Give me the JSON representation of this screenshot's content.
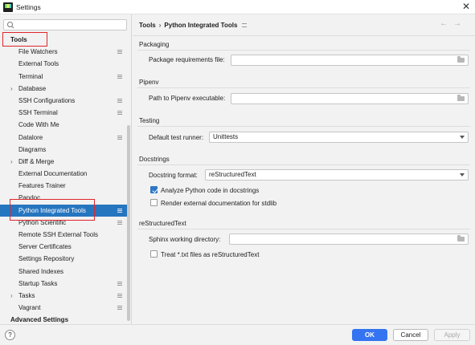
{
  "window": {
    "title": "Settings"
  },
  "search": {
    "placeholder": "",
    "value": ""
  },
  "sidebar": {
    "items": [
      {
        "label": "Tools",
        "type": "header"
      },
      {
        "label": "File Watchers",
        "proj": true
      },
      {
        "label": "External Tools"
      },
      {
        "label": "Terminal",
        "proj": true
      },
      {
        "label": "Database",
        "expandable": true
      },
      {
        "label": "SSH Configurations",
        "proj": true
      },
      {
        "label": "SSH Terminal",
        "proj": true
      },
      {
        "label": "Code With Me"
      },
      {
        "label": "Datalore",
        "proj": true
      },
      {
        "label": "Diagrams"
      },
      {
        "label": "Diff & Merge",
        "expandable": true
      },
      {
        "label": "External Documentation"
      },
      {
        "label": "Features Trainer"
      },
      {
        "label": "Pandoc"
      },
      {
        "label": "Python Integrated Tools",
        "proj": true,
        "selected": true
      },
      {
        "label": "Python Scientific",
        "proj": true
      },
      {
        "label": "Remote SSH External Tools"
      },
      {
        "label": "Server Certificates"
      },
      {
        "label": "Settings Repository"
      },
      {
        "label": "Shared Indexes"
      },
      {
        "label": "Startup Tasks",
        "proj": true
      },
      {
        "label": "Tasks",
        "expandable": true,
        "proj": true
      },
      {
        "label": "Vagrant",
        "proj": true
      },
      {
        "label": "Advanced Settings",
        "type": "header"
      }
    ]
  },
  "breadcrumb": {
    "parent": "Tools",
    "separator": "›",
    "current": "Python Integrated Tools"
  },
  "nav": {
    "back": "←",
    "forward": "→"
  },
  "packaging": {
    "title": "Packaging",
    "requirements_label": "Package requirements file:",
    "requirements_value": ""
  },
  "pipenv": {
    "title": "Pipenv",
    "path_label": "Path to Pipenv executable:",
    "path_value": ""
  },
  "testing": {
    "title": "Testing",
    "runner_label": "Default test runner:",
    "runner_value": "Unittests"
  },
  "docstrings": {
    "title": "Docstrings",
    "format_label": "Docstring format:",
    "format_value": "reStructuredText",
    "analyze_label": "Analyze Python code in docstrings",
    "analyze_checked": true,
    "render_label": "Render external documentation for stdlib",
    "render_checked": false
  },
  "rst": {
    "title": "reStructuredText",
    "sphinx_label": "Sphinx working directory:",
    "sphinx_value": "",
    "treat_label": "Treat *.txt files as reStructuredText",
    "treat_checked": false
  },
  "footer": {
    "help": "?",
    "ok": "OK",
    "cancel": "Cancel",
    "apply": "Apply"
  },
  "colors": {
    "accent": "#3574f0",
    "selection": "#2675bf",
    "highlight_box": "#e0262c"
  }
}
